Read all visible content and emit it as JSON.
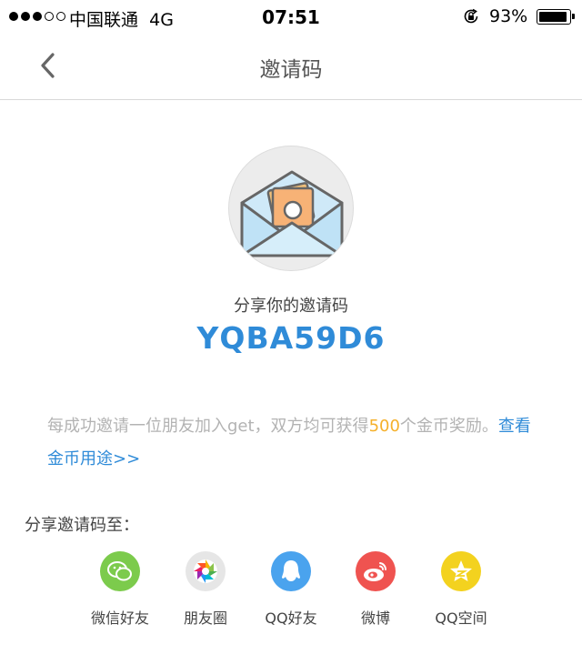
{
  "status_bar": {
    "carrier": "中国联通",
    "network": "4G",
    "time": "07:51",
    "battery": "93%",
    "battery_level": 0.93,
    "signal_filled": 3,
    "signal_total": 5
  },
  "nav": {
    "title": "邀请码"
  },
  "invite": {
    "share_label": "分享你的邀请码",
    "code": "YQBA59D6"
  },
  "description": {
    "text_before": "每成功邀请一位朋友加入get，双方均可获得",
    "number": "500",
    "text_after": "个金币奖励。",
    "link": "查看金币用途>>"
  },
  "share": {
    "title": "分享邀请码至：",
    "targets": [
      {
        "label": "微信好友",
        "icon": "wechat-icon",
        "color": "#7ccb4c"
      },
      {
        "label": "朋友圈",
        "icon": "moments-icon",
        "color": "#e6e6e6"
      },
      {
        "label": "QQ好友",
        "icon": "qq-icon",
        "color": "#4aa3ee"
      },
      {
        "label": "微博",
        "icon": "weibo-icon",
        "color": "#ef5350"
      },
      {
        "label": "QQ空间",
        "icon": "qzone-icon",
        "color": "#f3d21f"
      }
    ]
  },
  "colors": {
    "accent": "#2f8bd8",
    "highlight": "#f5b02a"
  }
}
